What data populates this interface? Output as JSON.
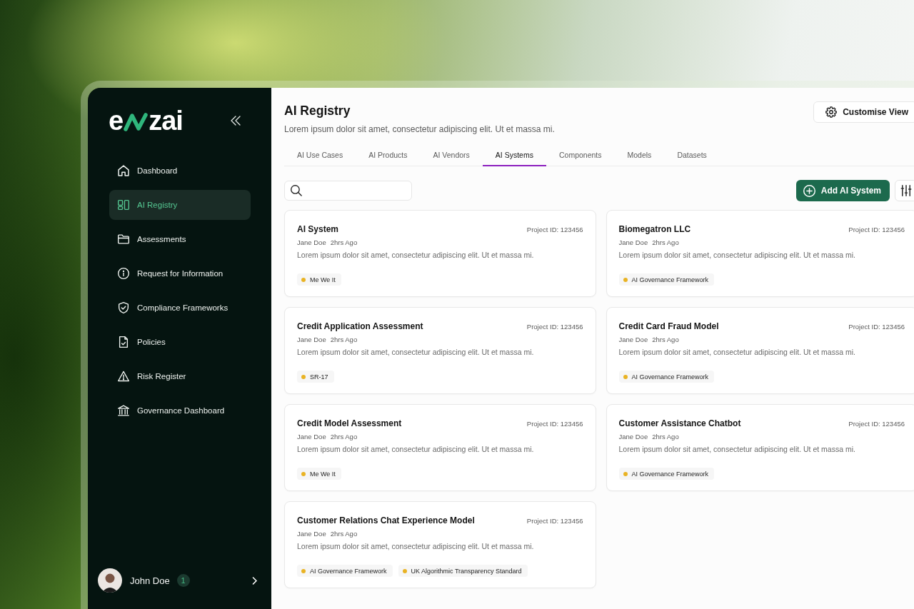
{
  "logo": {
    "before": "e",
    "after": "zai"
  },
  "sidebar": {
    "items": [
      {
        "label": "Dashboard",
        "selected": false
      },
      {
        "label": "AI Registry",
        "selected": true
      },
      {
        "label": "Assessments",
        "selected": false
      },
      {
        "label": "Request for Information",
        "selected": false
      },
      {
        "label": "Compliance Frameworks",
        "selected": false
      },
      {
        "label": "Policies",
        "selected": false
      },
      {
        "label": "Risk Register",
        "selected": false
      },
      {
        "label": "Governance Dashboard",
        "selected": false
      }
    ]
  },
  "user": {
    "name": "John Doe",
    "badge": "1"
  },
  "header": {
    "title": "AI Registry",
    "subtitle": "Lorem ipsum dolor sit amet, consectetur adipiscing elit. Ut et massa mi.",
    "customise_button": "Customise View"
  },
  "tabs": [
    {
      "label": "AI Use Cases",
      "selected": false
    },
    {
      "label": "AI Products",
      "selected": false
    },
    {
      "label": "AI Vendors",
      "selected": false
    },
    {
      "label": "AI Systems",
      "selected": true
    },
    {
      "label": "Components",
      "selected": false
    },
    {
      "label": "Models",
      "selected": false
    },
    {
      "label": "Datasets",
      "selected": false
    }
  ],
  "toolbar": {
    "add_button": "Add AI System"
  },
  "cards": [
    {
      "title": "AI System",
      "project_id": "Project ID: 123456",
      "author": "Jane Doe",
      "time": "2hrs Ago",
      "description": "Lorem ipsum dolor sit amet, consectetur adipiscing elit. Ut et massa mi.",
      "tags": [
        "Me We It"
      ]
    },
    {
      "title": "Biomegatron LLC",
      "project_id": "Project ID: 123456",
      "author": "Jane Doe",
      "time": "2hrs Ago",
      "description": "Lorem ipsum dolor sit amet, consectetur adipiscing elit. Ut et massa mi.",
      "tags": [
        "AI Governance Framework"
      ]
    },
    {
      "title": "Credit Application Assessment",
      "project_id": "Project ID: 123456",
      "author": "Jane Doe",
      "time": "2hrs Ago",
      "description": "Lorem ipsum dolor sit amet, consectetur adipiscing elit. Ut et massa mi.",
      "tags": [
        "SR-17"
      ]
    },
    {
      "title": "Credit Card Fraud Model",
      "project_id": "Project ID: 123456",
      "author": "Jane Doe",
      "time": "2hrs Ago",
      "description": "Lorem ipsum dolor sit amet, consectetur adipiscing elit. Ut et massa mi.",
      "tags": [
        "AI Governance Framework"
      ]
    },
    {
      "title": "Credit Model Assessment",
      "project_id": "Project ID: 123456",
      "author": "Jane Doe",
      "time": "2hrs Ago",
      "description": "Lorem ipsum dolor sit amet, consectetur adipiscing elit. Ut et massa mi.",
      "tags": [
        "Me We It"
      ]
    },
    {
      "title": "Customer Assistance Chatbot",
      "project_id": "Project ID: 123456",
      "author": "Jane Doe",
      "time": "2hrs Ago",
      "description": "Lorem ipsum dolor sit amet, consectetur adipiscing elit. Ut et massa mi.",
      "tags": [
        "AI Governance Framework"
      ]
    },
    {
      "title": "Customer Relations Chat Experience Model",
      "project_id": "Project ID: 123456",
      "author": "Jane Doe",
      "time": "2hrs Ago",
      "description": "Lorem ipsum dolor sit amet, consectetur adipiscing elit. Ut et massa mi.",
      "tags": [
        "AI Governance Framework",
        "UK Algorithmic Transparency Standard"
      ]
    }
  ]
}
